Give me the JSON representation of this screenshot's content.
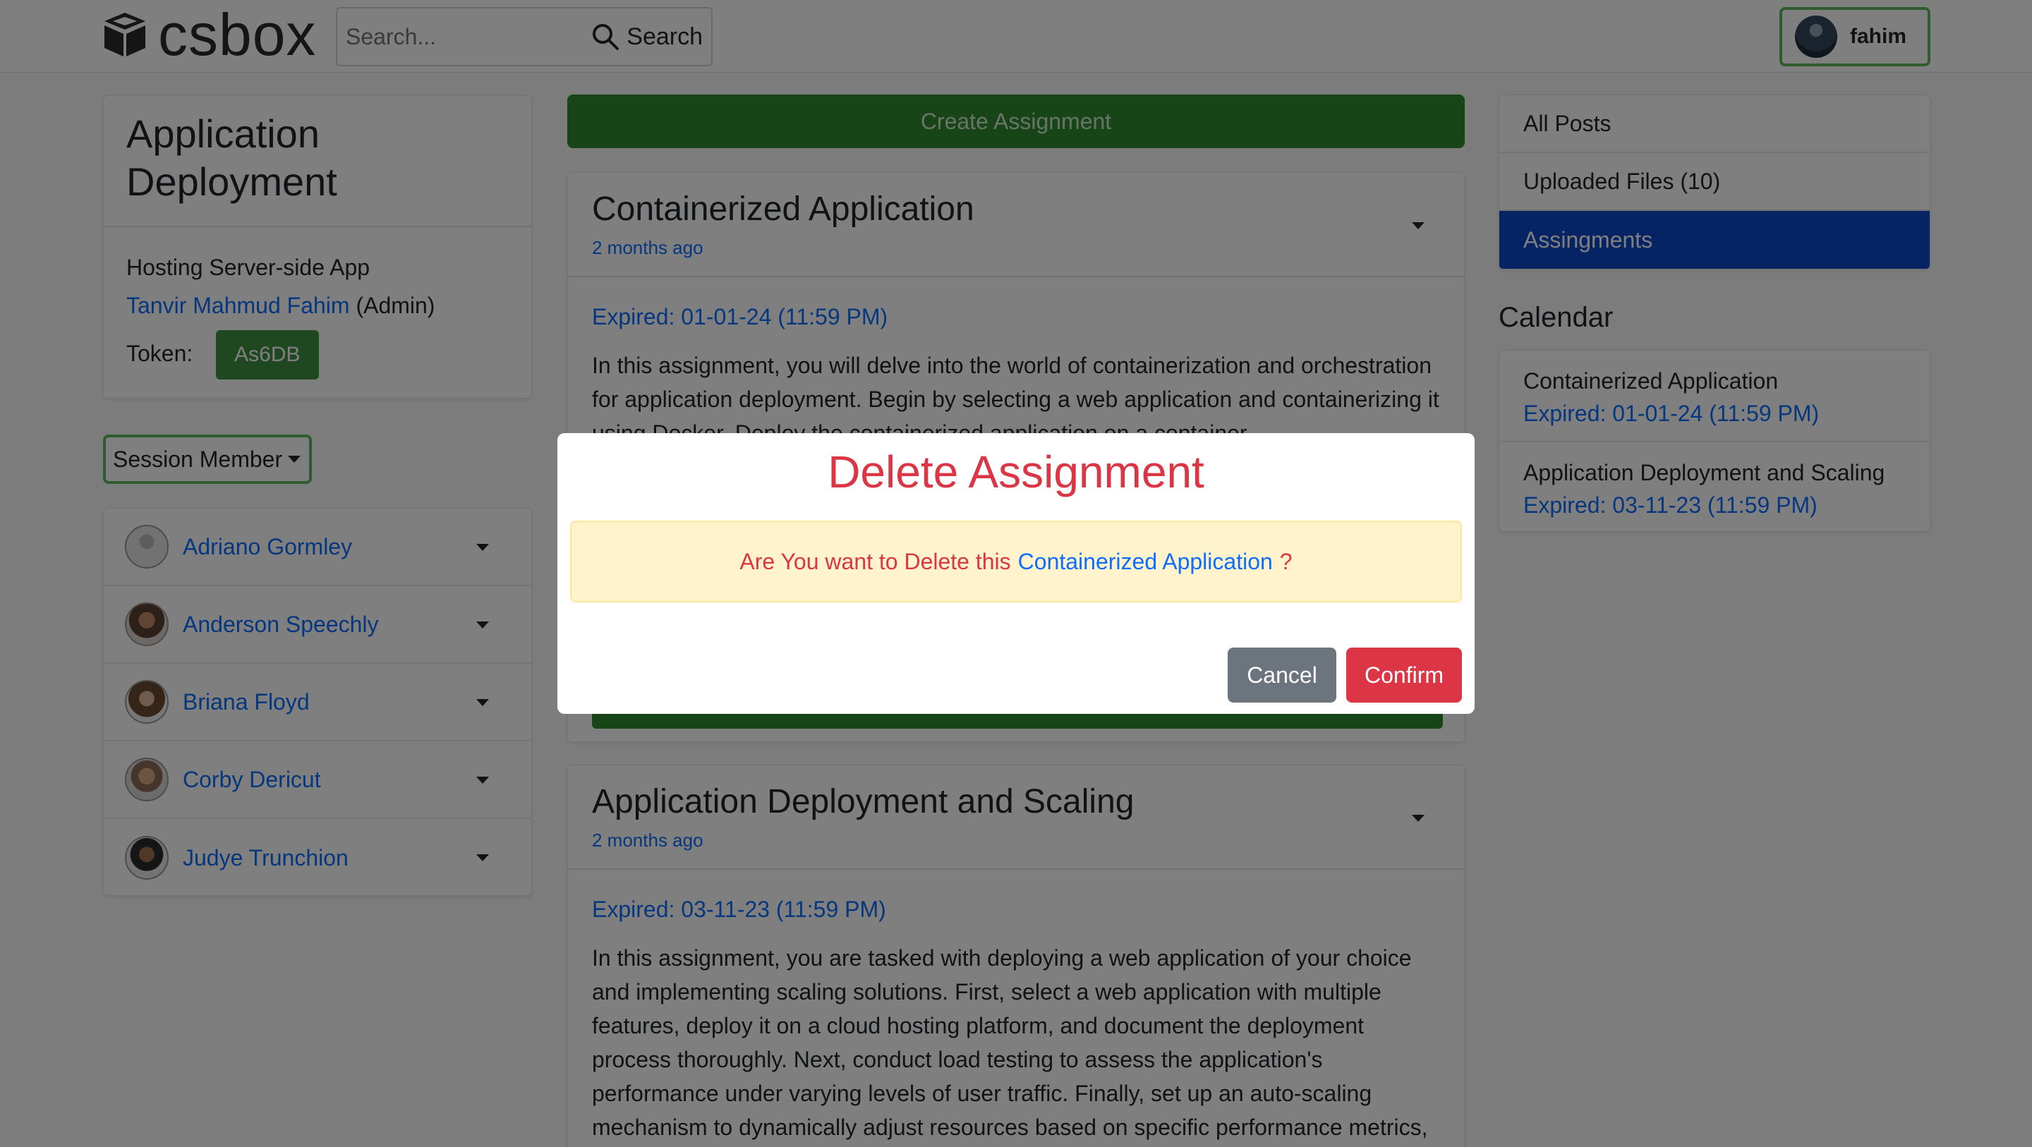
{
  "brand": {
    "name": "csbox"
  },
  "search": {
    "placeholder": "Search...",
    "button_label": "Search"
  },
  "user": {
    "name": "fahim"
  },
  "session": {
    "title": "Application Deployment",
    "subtitle": "Hosting Server-side App",
    "owner": "Tanvir Mahmud Fahim",
    "owner_role": "(Admin)",
    "token_label": "Token:",
    "token": "As6DB"
  },
  "session_member_button": "Session Member",
  "members": [
    {
      "name": "Adriano Gormley"
    },
    {
      "name": "Anderson Speechly"
    },
    {
      "name": "Briana Floyd"
    },
    {
      "name": "Corby Dericut"
    },
    {
      "name": "Judye Trunchion"
    }
  ],
  "create_button": "Create Assignment",
  "assignments": [
    {
      "title": "Containerized Application",
      "time": "2 months ago",
      "expired": "Expired: 01-01-24 (11:59 PM)",
      "description": "In this assignment, you will delve into the world of containerization and orchestration for application deployment. Begin by selecting a web application and containerizing it using Docker. Deploy the containerized application on a container"
    },
    {
      "title": "Application Deployment and Scaling",
      "time": "2 months ago",
      "expired": "Expired: 03-11-23 (11:59 PM)",
      "description": "In this assignment, you are tasked with deploying a web application of your choice and implementing scaling solutions. First, select a web application with multiple features, deploy it on a cloud hosting platform, and document the deployment process thoroughly. Next, conduct load testing to assess the application's performance under varying levels of user traffic. Finally, set up an auto-scaling mechanism to dynamically adjust resources based on specific performance metrics,"
    }
  ],
  "right_nav": [
    {
      "label": "All Posts"
    },
    {
      "label": "Uploaded Files (10)"
    },
    {
      "label": "Assingments"
    }
  ],
  "calendar": {
    "title": "Calendar",
    "items": [
      {
        "title": "Containerized Application",
        "expired": "Expired: 01-01-24 (11:59 PM)"
      },
      {
        "title": "Application Deployment and Scaling",
        "expired": "Expired: 03-11-23 (11:59 PM)"
      }
    ]
  },
  "modal": {
    "title": "Delete Assignment",
    "message_prefix": "Are You want to Delete this",
    "message_target": "Containerized Application",
    "message_suffix": "?",
    "cancel": "Cancel",
    "confirm": "Confirm"
  },
  "colors": {
    "primary": "#0d6efd",
    "success": "#2f8a2f",
    "danger": "#dc3545",
    "active_nav": "#0d47c9",
    "alert_bg": "#fff3cd"
  }
}
